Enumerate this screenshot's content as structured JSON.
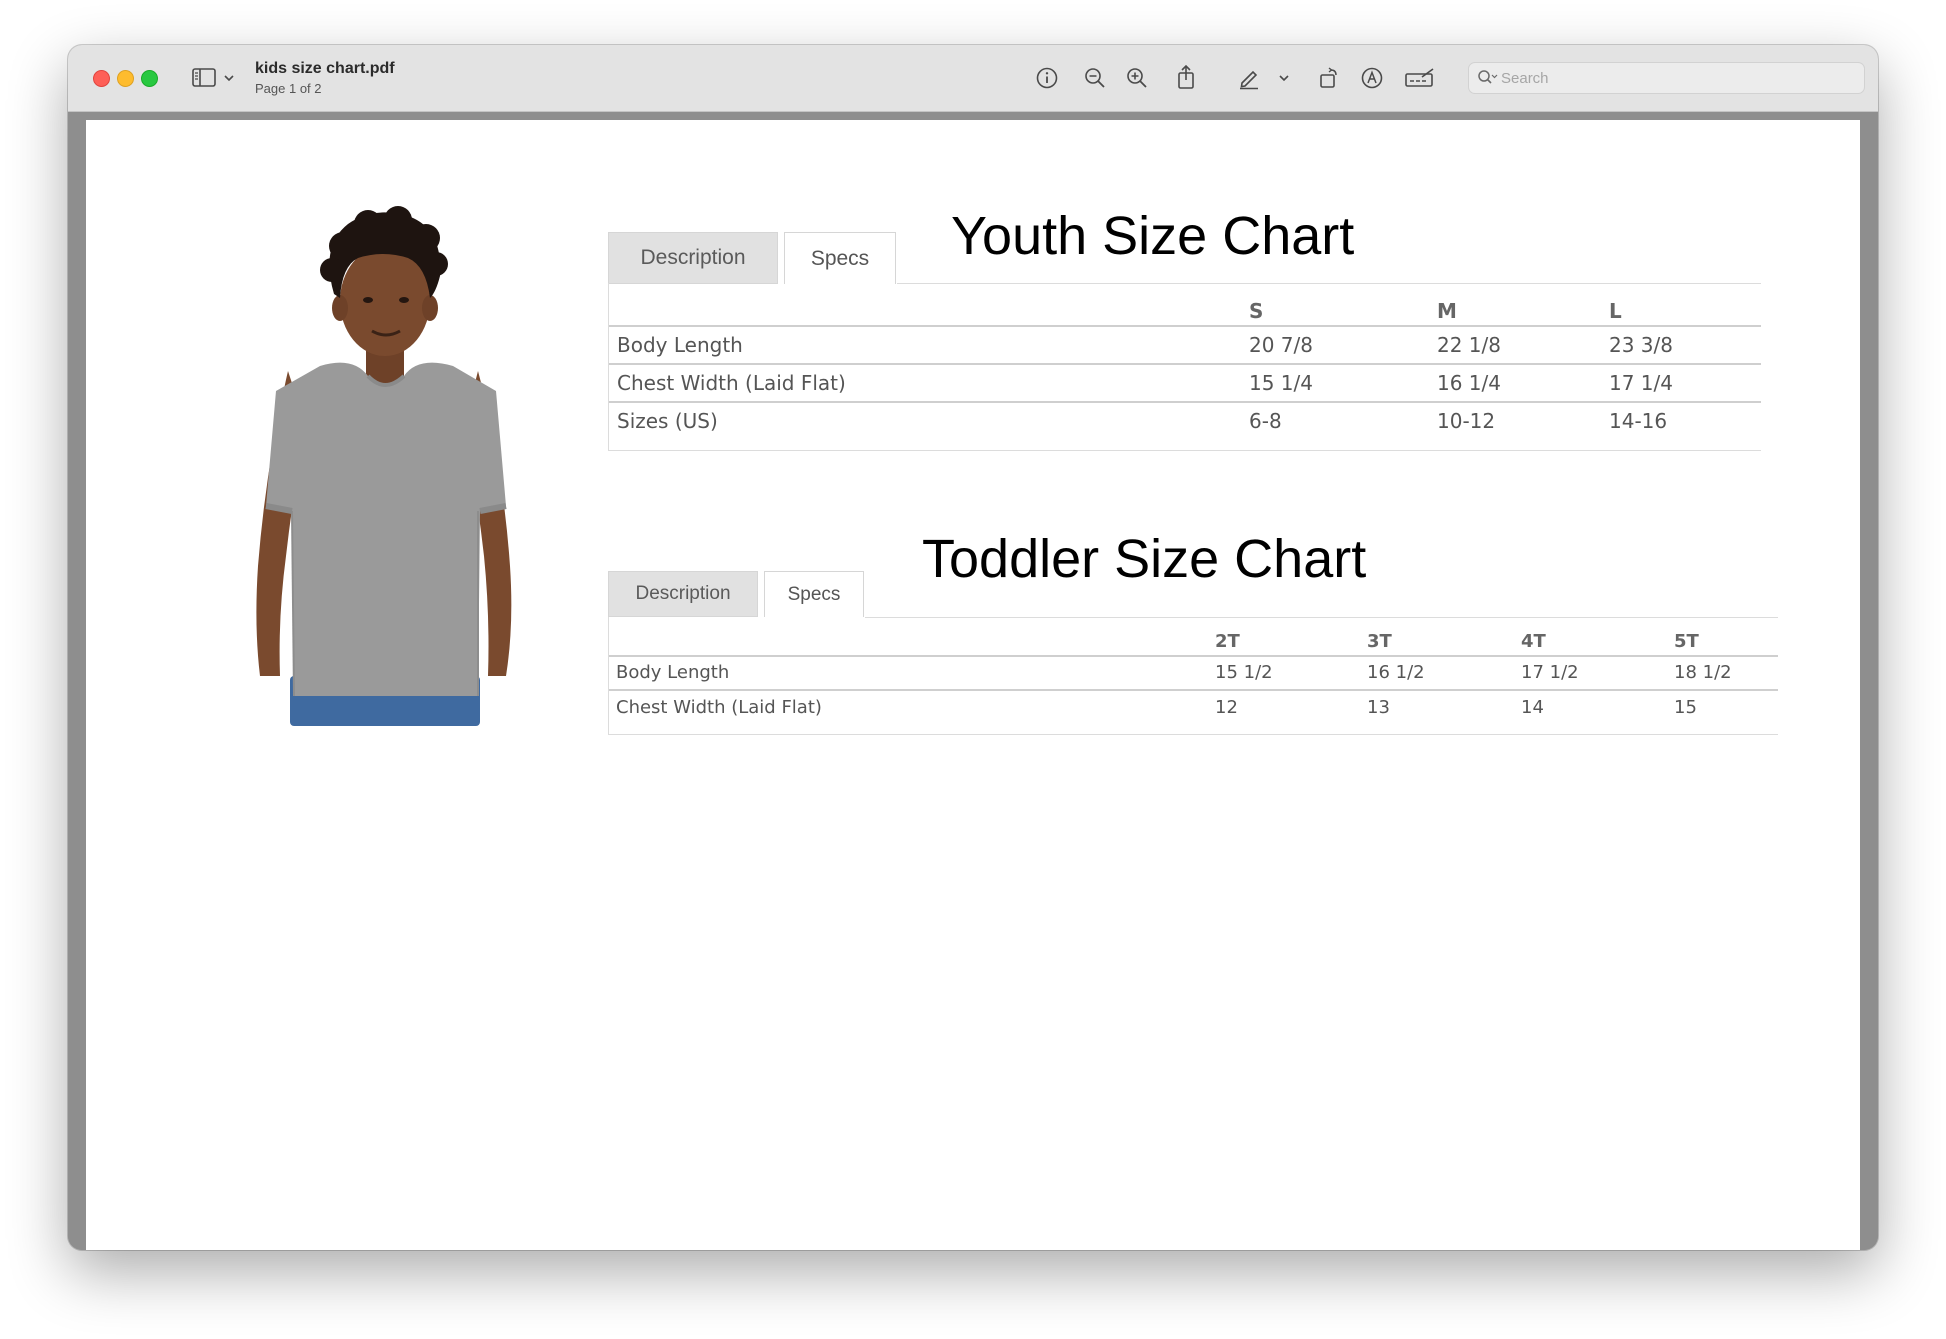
{
  "window": {
    "file_name": "kids size chart.pdf",
    "page_indicator": "Page 1 of 2",
    "search_placeholder": "Search"
  },
  "toolbar_icons": [
    "sidebar-icon",
    "chevron-down-icon",
    "info-icon",
    "zoom-out-icon",
    "zoom-in-icon",
    "share-icon",
    "markup-pen-icon",
    "chevron-down-icon",
    "rotate-icon",
    "annotate-icon",
    "signature-icon",
    "search-icon"
  ],
  "youth": {
    "title": "Youth Size Chart",
    "tabs": [
      "Description",
      "Specs"
    ],
    "active_tab": "Specs",
    "columns": [
      "",
      "S",
      "M",
      "L"
    ],
    "rows": [
      {
        "label": "Body Length",
        "values": [
          "20 7/8",
          "22 1/8",
          "23 3/8"
        ]
      },
      {
        "label": "Chest Width (Laid Flat)",
        "values": [
          "15 1/4",
          "16 1/4",
          "17 1/4"
        ]
      },
      {
        "label": "Sizes (US)",
        "values": [
          "6-8",
          "10-12",
          "14-16"
        ]
      }
    ]
  },
  "toddler": {
    "title": "Toddler Size Chart",
    "tabs": [
      "Description",
      "Specs"
    ],
    "active_tab": "Specs",
    "columns": [
      "",
      "2T",
      "3T",
      "4T",
      "5T"
    ],
    "rows": [
      {
        "label": "Body Length",
        "values": [
          "15 1/2",
          "16 1/2",
          "17 1/2",
          "18 1/2"
        ]
      },
      {
        "label": "Chest Width (Laid Flat)",
        "values": [
          "12",
          "13",
          "14",
          "15"
        ]
      }
    ]
  },
  "colors": {
    "shirt": "#9a9a9a",
    "skin": "#7a4a2e",
    "hair": "#1e1410",
    "jeans": "#3f6aa0"
  }
}
